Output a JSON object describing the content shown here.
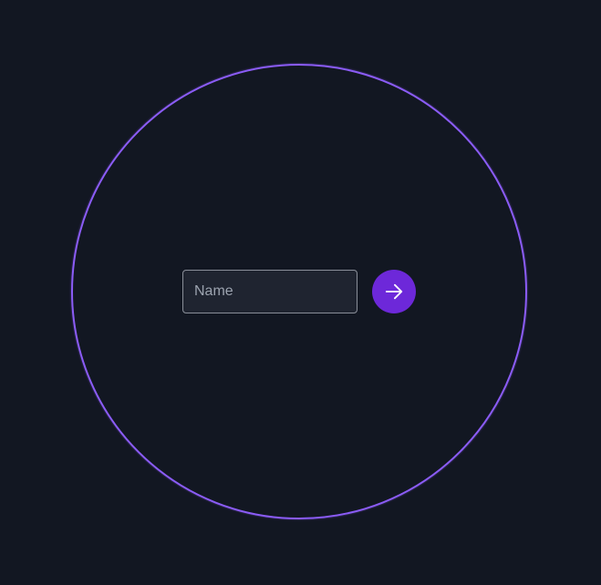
{
  "form": {
    "name_placeholder": "Name",
    "name_value": "",
    "submit_icon": "arrow-right-icon"
  },
  "colors": {
    "background": "#121722",
    "ring": "#8b5cf6",
    "button": "#6d28d9",
    "input_bg": "#1f2430",
    "input_border": "#8a8f99"
  }
}
